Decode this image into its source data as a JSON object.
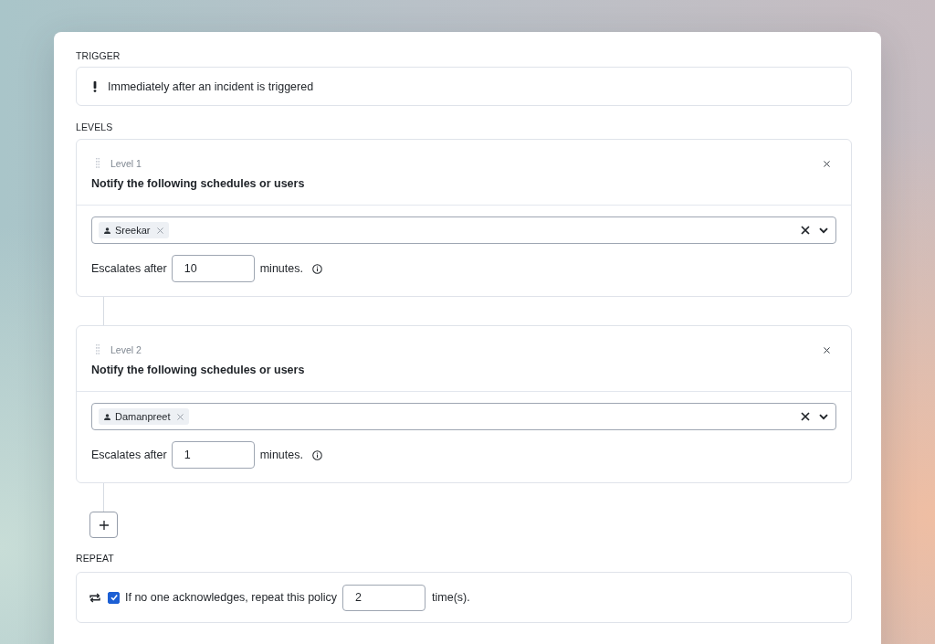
{
  "trigger": {
    "heading": "TRIGGER",
    "text": "Immediately after an incident is triggered"
  },
  "levels": {
    "heading": "LEVELS",
    "items": [
      {
        "label": "Level 1",
        "title": "Notify the following schedules or users",
        "recipients": [
          "Sreekar"
        ],
        "escalates_label": "Escalates after",
        "minutes": "10",
        "unit": "minutes."
      },
      {
        "label": "Level 2",
        "title": "Notify the following schedules or users",
        "recipients": [
          "Damanpreet"
        ],
        "escalates_label": "Escalates after",
        "minutes": "1",
        "unit": "minutes."
      }
    ]
  },
  "repeat": {
    "heading": "REPEAT",
    "checked": true,
    "text": "If no one acknowledges, repeat this policy",
    "times": "2",
    "unit": "time(s)."
  }
}
